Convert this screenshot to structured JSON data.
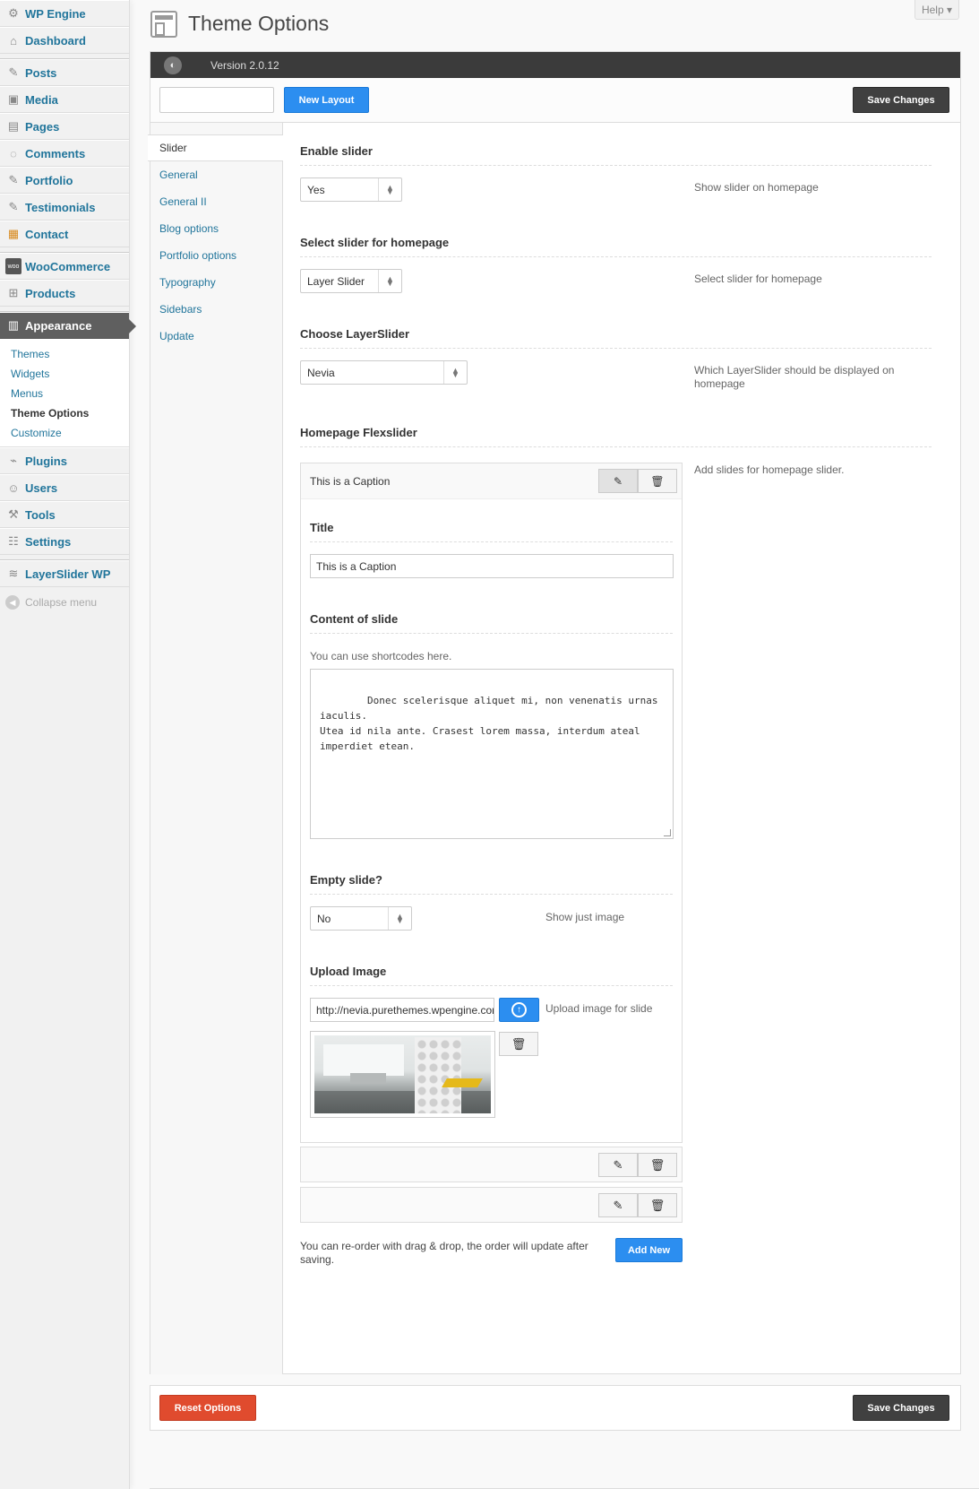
{
  "sidebar": {
    "items": [
      {
        "label": "WP Engine",
        "icon": "gear-icon"
      },
      {
        "label": "Dashboard",
        "icon": "home-icon"
      },
      {
        "label": "Posts",
        "icon": "pin-icon"
      },
      {
        "label": "Media",
        "icon": "media-icon"
      },
      {
        "label": "Pages",
        "icon": "pages-icon"
      },
      {
        "label": "Comments",
        "icon": "comment-icon"
      },
      {
        "label": "Portfolio",
        "icon": "pin-icon"
      },
      {
        "label": "Testimonials",
        "icon": "pin-icon"
      },
      {
        "label": "Contact",
        "icon": "contact-icon"
      },
      {
        "label": "WooCommerce",
        "icon": "woo-icon"
      },
      {
        "label": "Products",
        "icon": "cart-icon"
      },
      {
        "label": "Appearance",
        "icon": "appearance-icon"
      },
      {
        "label": "Plugins",
        "icon": "plug-icon"
      },
      {
        "label": "Users",
        "icon": "users-icon"
      },
      {
        "label": "Tools",
        "icon": "tools-icon"
      },
      {
        "label": "Settings",
        "icon": "settings-icon"
      },
      {
        "label": "LayerSlider WP",
        "icon": "layers-icon"
      }
    ],
    "appearance_sub": [
      "Themes",
      "Widgets",
      "Menus",
      "Theme Options",
      "Customize"
    ],
    "collapse_label": "Collapse menu"
  },
  "header": {
    "help_label": "Help ▾",
    "title": "Theme Options"
  },
  "panel": {
    "version": "Version 2.0.12",
    "new_layout_label": "New Layout",
    "save_label": "Save Changes",
    "reset_label": "Reset Options"
  },
  "tabs": [
    "Slider",
    "General",
    "General II",
    "Blog options",
    "Portfolio options",
    "Typography",
    "Sidebars",
    "Update"
  ],
  "options": {
    "enable_slider": {
      "heading": "Enable slider",
      "value": "Yes",
      "desc": "Show slider on homepage"
    },
    "select_slider": {
      "heading": "Select slider for homepage",
      "value": "Layer Slider",
      "desc": "Select slider for homepage"
    },
    "choose_layerslider": {
      "heading": "Choose LayerSlider",
      "value": "Nevia",
      "desc": "Which LayerSlider should be displayed on homepage"
    },
    "flexslider": {
      "heading": "Homepage Flexslider",
      "desc": "Add slides for homepage slider."
    }
  },
  "slide": {
    "caption": "This is a Caption",
    "title_heading": "Title",
    "title_value": "This is a Caption",
    "content_heading": "Content of slide",
    "content_hint": "You can use shortcodes here.",
    "content_value": "Donec scelerisque aliquet mi, non venenatis urnas iaculis.\nUtea id nila ante. Crasest lorem massa, interdum ateal\nimperdiet etean.",
    "empty_heading": "Empty slide?",
    "empty_value": "No",
    "empty_desc": "Show just image",
    "upload_heading": "Upload Image",
    "upload_value": "http://nevia.purethemes.wpengine.com",
    "upload_desc": "Upload image for slide"
  },
  "reorder_hint": "You can re-order with drag & drop, the order will update after saving.",
  "add_new_label": "Add New"
}
